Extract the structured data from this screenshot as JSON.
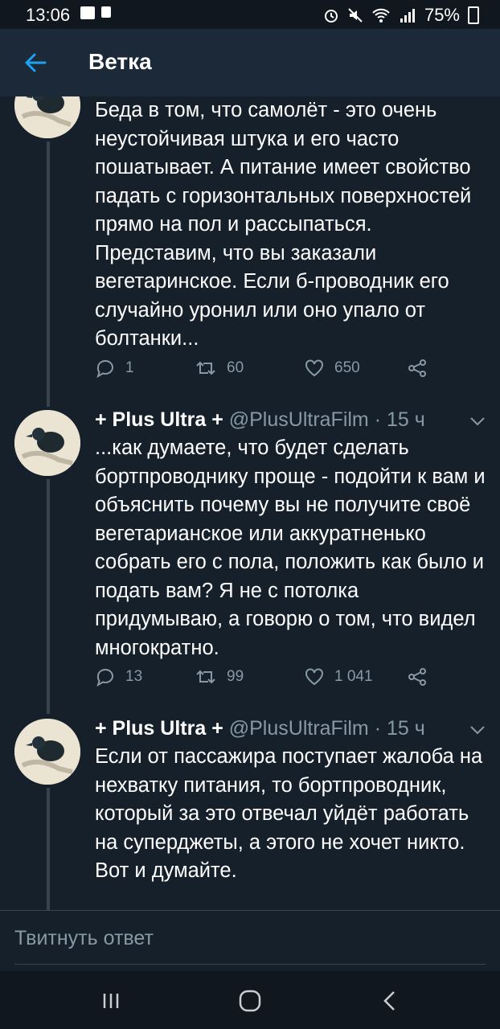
{
  "status_bar": {
    "time": "13:06",
    "battery": "75%"
  },
  "header": {
    "title": "Ветка"
  },
  "tweets": [
    {
      "text": "Беда в том, что самолёт - это очень неустойчивая штука и его часто пошатывает. А питание имеет свойство падать с горизонтальных поверхностей прямо на пол и рассыпаться. Представим, что вы заказали вегетаринское. Если б-проводник его случайно уронил или оно упало от болтанки...",
      "replies": "1",
      "retweets": "60",
      "likes": "650"
    },
    {
      "name": "+ Plus Ultra +",
      "handle": "@PlusUltraFilm",
      "dot": "·",
      "time": "15 ч",
      "text": "...как думаете, что будет сделать бортпроводнику проще - подойти к вам и объяснить почему вы не получите своё вегетарианское или аккуратненько собрать его с пола, положить как было и подать вам? Я не с потолка придумываю, а говорю о том, что видел многократно.",
      "replies": "13",
      "retweets": "99",
      "likes": "1 041"
    },
    {
      "name": "+ Plus Ultra +",
      "handle": "@PlusUltraFilm",
      "dot": "·",
      "time": "15 ч",
      "text": "Если от пассажира поступает жалоба на нехватку питания, то бортпроводник, который за это отвечал уйдёт работать на суперджеты, а этого не хочет никто. Вот и думайте."
    }
  ],
  "reply_bar": {
    "placeholder": "Твитнуть ответ"
  },
  "colors": {
    "background": "#15202b",
    "header": "#1c2938",
    "accent": "#1da1f2",
    "muted": "#8899a6",
    "line": "#38444d"
  },
  "icons": [
    "alarm-icon",
    "mute-icon",
    "wifi-icon",
    "signal-icon",
    "battery-icon",
    "back-arrow-icon",
    "reply-icon",
    "retweet-icon",
    "like-icon",
    "share-icon",
    "chevron-down-icon",
    "recents-icon",
    "home-icon",
    "back-icon"
  ]
}
